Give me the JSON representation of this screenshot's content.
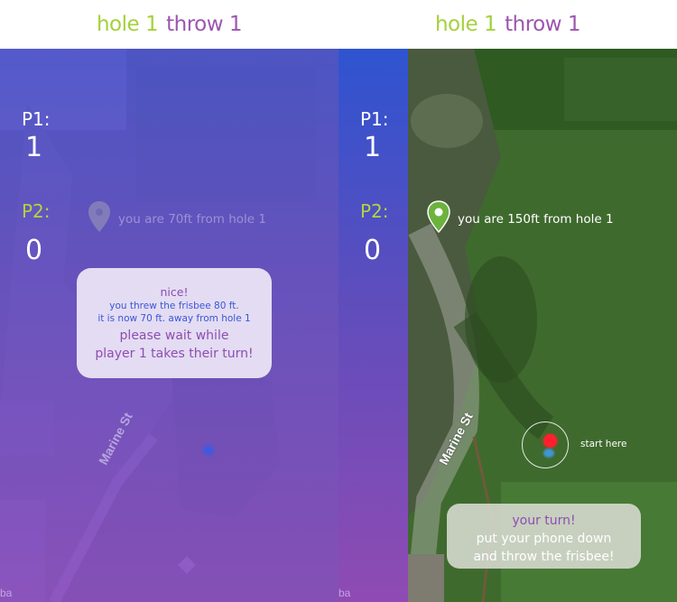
{
  "screens": [
    {
      "header": {
        "hole": "hole 1",
        "throw": "throw 1"
      },
      "scores": {
        "p1_label": "P1:",
        "p1_value": "1",
        "p2_label": "P2:",
        "p2_value": "0"
      },
      "distance_text": "you are 70ft from hole 1",
      "message": {
        "title": "nice!",
        "line1": "you threw the frisbee 80 ft.",
        "line2": "it is now 70 ft. away from hole 1",
        "wait1": "please wait while",
        "wait2": "player 1 takes their turn!"
      },
      "map": {
        "street": "Marine St",
        "corner_label": "ba"
      }
    },
    {
      "header": {
        "hole": "hole 1",
        "throw": "throw 1"
      },
      "scores": {
        "p1_label": "P1:",
        "p1_value": "1",
        "p2_label": "P2:",
        "p2_value": "0"
      },
      "distance_text": "you are 150ft from hole 1",
      "start_label": "start here",
      "turn": {
        "title": "your turn!",
        "line1": "put your phone down",
        "line2": "and throw the frisbee!"
      },
      "map": {
        "street": "Marine St",
        "corner_label": "ba"
      }
    }
  ],
  "colors": {
    "green_accent": "#a5d13a",
    "purple_accent": "#9b56b0",
    "pin_green": "#6cb33e",
    "start_dot": "#ff1f2e",
    "blue_text": "#3c55d8"
  },
  "icons": {
    "location_pin": "map-pin-icon",
    "start_marker": "start-position-icon"
  }
}
